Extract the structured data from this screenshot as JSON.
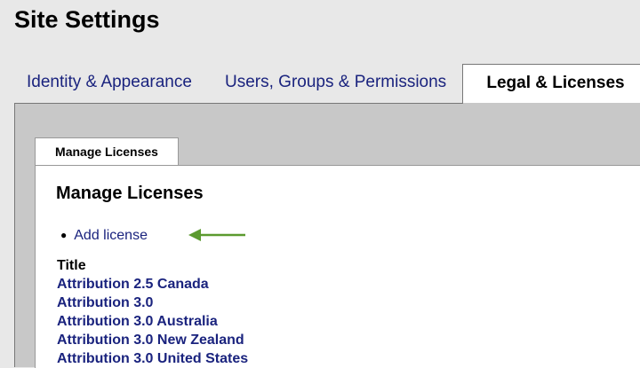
{
  "page": {
    "title": "Site Settings"
  },
  "main_tabs": [
    {
      "label": "Identity & Appearance",
      "active": false
    },
    {
      "label": "Users, Groups & Permissions",
      "active": false
    },
    {
      "label": "Legal & Licenses",
      "active": true
    }
  ],
  "sub_tab": {
    "label": "Manage Licenses"
  },
  "content": {
    "heading": "Manage Licenses",
    "actions": [
      {
        "label": "Add license"
      }
    ],
    "table": {
      "header": "Title",
      "rows": [
        "Attribution 2.5 Canada",
        "Attribution 3.0",
        "Attribution 3.0 Australia",
        "Attribution 3.0 New Zealand",
        "Attribution 3.0 United States"
      ]
    }
  },
  "colors": {
    "link": "#1a237e",
    "arrow": "#5b9a2f",
    "outer_panel": "#c8c8c8",
    "page_background": "#e8e8e8"
  },
  "icons": {
    "annotation_arrow": "left-arrow-icon"
  }
}
